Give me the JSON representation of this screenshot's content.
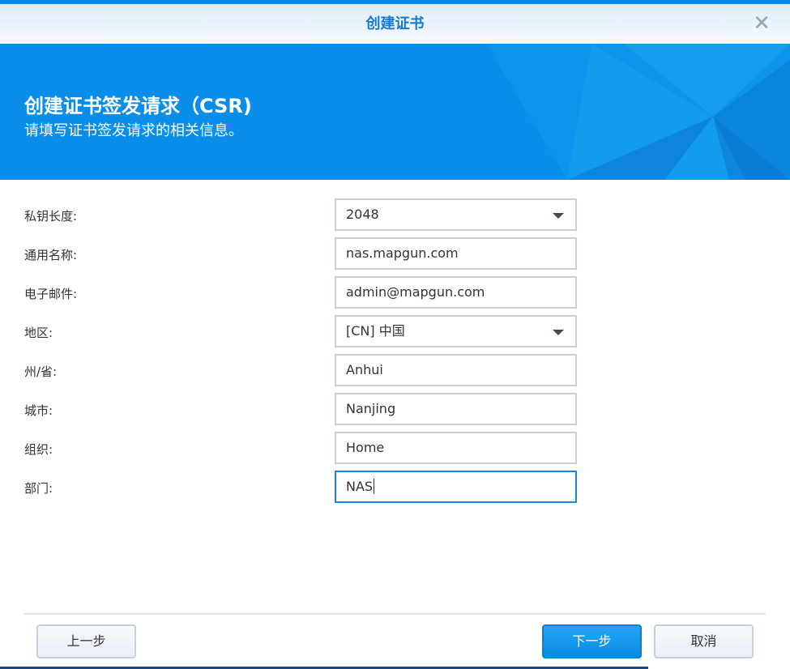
{
  "window": {
    "title": "创建证书",
    "close_icon": "close-icon"
  },
  "banner": {
    "title": "创建证书签发请求（CSR)",
    "subtitle": "请填写证书签发请求的相关信息。"
  },
  "form": [
    {
      "label": "私钥长度:",
      "value": "2048",
      "type": "select"
    },
    {
      "label": "通用名称:",
      "value": "nas.mapgun.com",
      "type": "text"
    },
    {
      "label": "电子邮件:",
      "value": "admin@mapgun.com",
      "type": "text"
    },
    {
      "label": "地区:",
      "value": "[CN] 中国",
      "type": "select"
    },
    {
      "label": "州/省:",
      "value": "Anhui",
      "type": "text"
    },
    {
      "label": "城市:",
      "value": "Nanjing",
      "type": "text"
    },
    {
      "label": "组织:",
      "value": "Home",
      "type": "text"
    },
    {
      "label": "部门:",
      "value": "NAS",
      "type": "text",
      "focused": true
    }
  ],
  "footer": {
    "back": "上一步",
    "next": "下一步",
    "cancel": "取消"
  },
  "colors": {
    "accent": "#0a8ee9",
    "title": "#1478d4"
  }
}
